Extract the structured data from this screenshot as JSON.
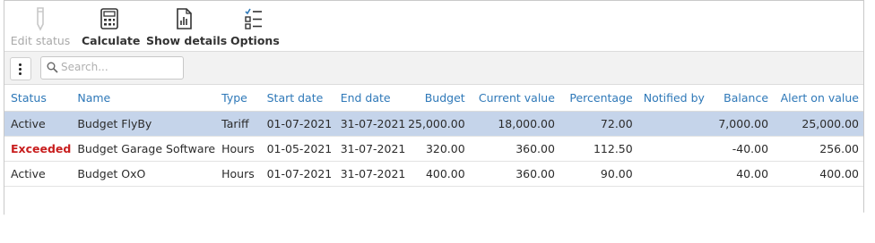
{
  "toolbar": {
    "edit_status": "Edit status",
    "calculate": "Calculate",
    "show_details": "Show details",
    "options": "Options"
  },
  "search": {
    "placeholder": "Search..."
  },
  "columns": {
    "status": "Status",
    "name": "Name",
    "type": "Type",
    "start_date": "Start date",
    "end_date": "End date",
    "budget": "Budget",
    "current_value": "Current value",
    "percentage": "Percentage",
    "notified_by": "Notified by",
    "balance": "Balance",
    "alert_on_value": "Alert on value"
  },
  "rows": [
    {
      "status": "Active",
      "name": "Budget FlyBy",
      "type": "Tariff",
      "start_date": "01-07-2021",
      "end_date": "31-07-2021",
      "budget": "25,000.00",
      "current_value": "18,000.00",
      "percentage": "72.00",
      "notified_by": "",
      "balance": "7,000.00",
      "alert_on_value": "25,000.00"
    },
    {
      "status": "Exceeded",
      "name": "Budget Garage Software",
      "type": "Hours",
      "start_date": "01-05-2021",
      "end_date": "31-07-2021",
      "budget": "320.00",
      "current_value": "360.00",
      "percentage": "112.50",
      "notified_by": "",
      "balance": "-40.00",
      "alert_on_value": "256.00"
    },
    {
      "status": "Active",
      "name": "Budget OxO",
      "type": "Hours",
      "start_date": "01-07-2021",
      "end_date": "31-07-2021",
      "budget": "400.00",
      "current_value": "360.00",
      "percentage": "90.00",
      "notified_by": "",
      "balance": "40.00",
      "alert_on_value": "400.00"
    }
  ],
  "colors": {
    "header_text": "#2e78b8",
    "selected_row": "#c5d4ea",
    "exceeded_text": "#c81e1e",
    "disabled_text": "#a9a9a9"
  },
  "icons": {
    "edit_status": "pencil-icon",
    "calculate": "calculator-icon",
    "show_details": "document-chart-icon",
    "options": "checklist-icon",
    "search": "magnifier-icon",
    "menu": "kebab-menu-icon"
  }
}
